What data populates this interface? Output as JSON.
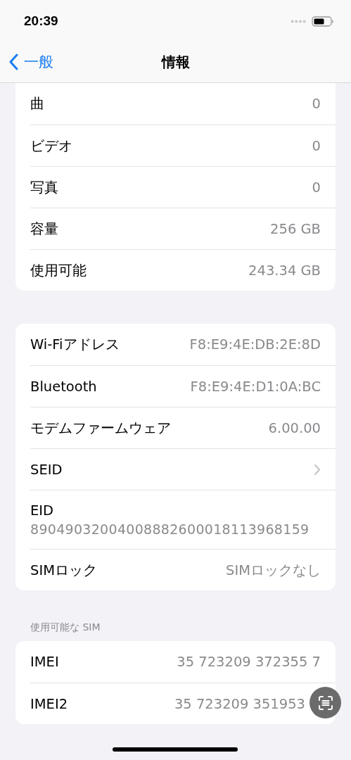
{
  "status_bar": {
    "time": "20:39"
  },
  "nav": {
    "back": "一般",
    "title": "情報"
  },
  "groups": [
    {
      "cut_top": true,
      "rows": [
        {
          "kind": "value",
          "label": "曲",
          "value": "0"
        },
        {
          "kind": "value",
          "label": "ビデオ",
          "value": "0"
        },
        {
          "kind": "value",
          "label": "写真",
          "value": "0"
        },
        {
          "kind": "value",
          "label": "容量",
          "value": "256 GB"
        },
        {
          "kind": "value",
          "label": "使用可能",
          "value": "243.34 GB"
        }
      ]
    },
    {
      "cut_top": false,
      "rows": [
        {
          "kind": "value",
          "label": "Wi-Fiアドレス",
          "value": "F8:E9:4E:DB:2E:8D"
        },
        {
          "kind": "value",
          "label": "Bluetooth",
          "value": "F8:E9:4E:D1:0A:BC"
        },
        {
          "kind": "value",
          "label": "モデムファームウェア",
          "value": "6.00.00"
        },
        {
          "kind": "chevron",
          "label": "SEID"
        },
        {
          "kind": "stacked",
          "label": "EID",
          "value": "89049032004008882600018113968159"
        },
        {
          "kind": "value",
          "label": "SIMロック",
          "value": "SIMロックなし"
        }
      ]
    },
    {
      "header": "使用可能な SIM",
      "rows": [
        {
          "kind": "value",
          "label": "IMEI",
          "value": "35 723209 372355 7"
        },
        {
          "kind": "value",
          "label": "IMEI2",
          "value": "35 723209 351953"
        }
      ]
    }
  ]
}
